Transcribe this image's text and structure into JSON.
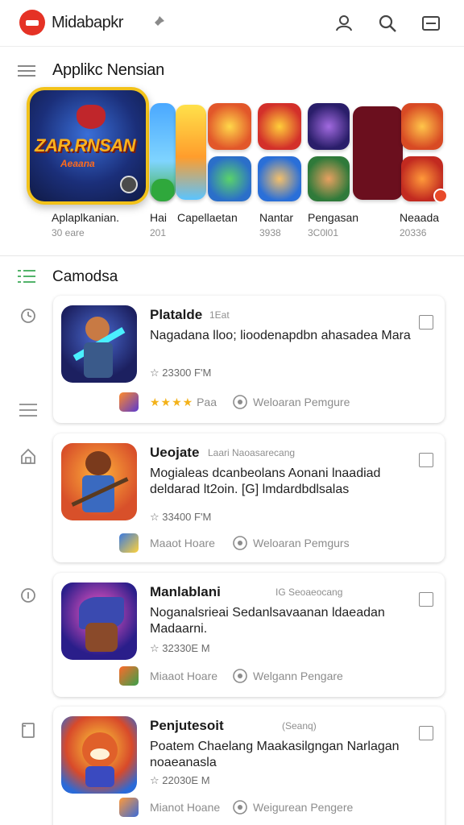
{
  "header": {
    "brand": "Midabapkr",
    "crumb": "",
    "icons": [
      "app-logo-icon",
      "pin-icon",
      "account-icon",
      "search-icon",
      "more-icon"
    ]
  },
  "featured": {
    "title": "Applikc Nensian",
    "hero_text_1": "ZAR.RNSAN",
    "hero_text_2": "Aeaana",
    "items": [
      {
        "label": "Aplaplkanian.",
        "sub": "30 eare"
      },
      {
        "label": "Hai",
        "sub": "201"
      },
      {
        "label": "Capellaetan",
        "sub": ""
      },
      {
        "label": "Nantar",
        "sub": "3938"
      },
      {
        "label": "Pengasan",
        "sub": "3C0l01"
      },
      {
        "label": "Neaada",
        "sub": "20336"
      }
    ]
  },
  "category": {
    "title": "Camodsa"
  },
  "cards": [
    {
      "title": "Platalde",
      "tag": "1Eat",
      "desc": "Nagadana lloo; lioodenapdbn ahasadea Mara",
      "meta": "☆ 23300 F'M",
      "stars": "★★★★",
      "foot_left": "Paa",
      "foot_right": "Weloaran Pemgure"
    },
    {
      "title": "Ueojate",
      "tag": "Laari Naoasarecang",
      "desc": "Mogialeas dcanbeolans Aonani lnaadiad deldarad lt2oin. [G] lmdardbdlsalas",
      "meta": "☆ 33400 F'M",
      "stars": "",
      "foot_left": "Maaot Hoare",
      "foot_right": "Weloaran Pemgurs"
    },
    {
      "title": "Manlablani",
      "tag": "IG Seoaeocang",
      "desc": "Noganalsrieai Sedanlsavaanan ldaeadan Madaarni.",
      "meta": "☆ 32330E M",
      "stars": "",
      "foot_left": "Miaaot Hoare",
      "foot_right": "Welgann Pengare"
    },
    {
      "title": "Penjutesoit",
      "tag": "(Seanq)",
      "desc": "Poatem Chaelang Maakasilgngan Narlagan noaeanasla",
      "meta": "☆ 22030E M",
      "stars": "",
      "foot_left": "Mianot Hoane",
      "foot_right": "Weigurean Pengere"
    }
  ],
  "sidebar_icons": [
    "clock-icon",
    "list-icon",
    "home-icon",
    "info-icon",
    "bookmark-icon"
  ],
  "colors": {
    "accent": "#e53225",
    "hero_frame": "#f2c21a",
    "star": "#f3b21a"
  }
}
